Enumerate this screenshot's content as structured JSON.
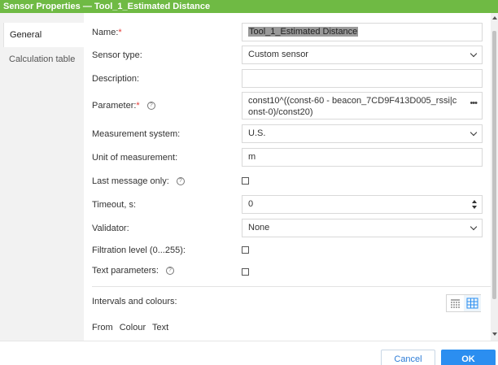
{
  "window": {
    "title": "Sensor Properties — Tool_1_Estimated Distance"
  },
  "sidebar": {
    "items": [
      {
        "label": "General",
        "active": true
      },
      {
        "label": "Calculation table",
        "active": false
      }
    ]
  },
  "form": {
    "name": {
      "label": "Name:",
      "required_mark": "*",
      "value": "Tool_1_Estimated Distance"
    },
    "sensor_type": {
      "label": "Sensor type:",
      "value": "Custom sensor"
    },
    "description": {
      "label": "Description:",
      "value": ""
    },
    "parameter": {
      "label": "Parameter:",
      "required_mark": "*",
      "help": "?",
      "value": "const10^((const-60 - beacon_7CD9F413D005_rssi|const-0)/const20)",
      "more": "•••"
    },
    "measurement_system": {
      "label": "Measurement system:",
      "value": "U.S."
    },
    "unit": {
      "label": "Unit of measurement:",
      "value": "m"
    },
    "last_message_only": {
      "label": "Last message only:",
      "help": "?",
      "checked": false
    },
    "timeout": {
      "label": "Timeout, s:",
      "value": "0"
    },
    "validator": {
      "label": "Validator:",
      "value": "None"
    },
    "filtration": {
      "label": "Filtration level (0...255):",
      "checked": false
    },
    "text_parameters": {
      "label": "Text parameters:",
      "help": "?",
      "checked": false
    },
    "intervals": {
      "label": "Intervals and colours:"
    },
    "table_columns": [
      "From",
      "Colour",
      "Text"
    ]
  },
  "footer": {
    "cancel_label": "Cancel",
    "ok_label": "OK"
  },
  "colors": {
    "titlebar": "#6fba44",
    "primary": "#2b8ef0",
    "link": "#2e7dd7",
    "required": "#e53935"
  },
  "icons": [
    "chevron-down-icon",
    "more-dots-icon",
    "help-icon",
    "spinner-icon",
    "list-view-icon",
    "table-view-icon"
  ]
}
